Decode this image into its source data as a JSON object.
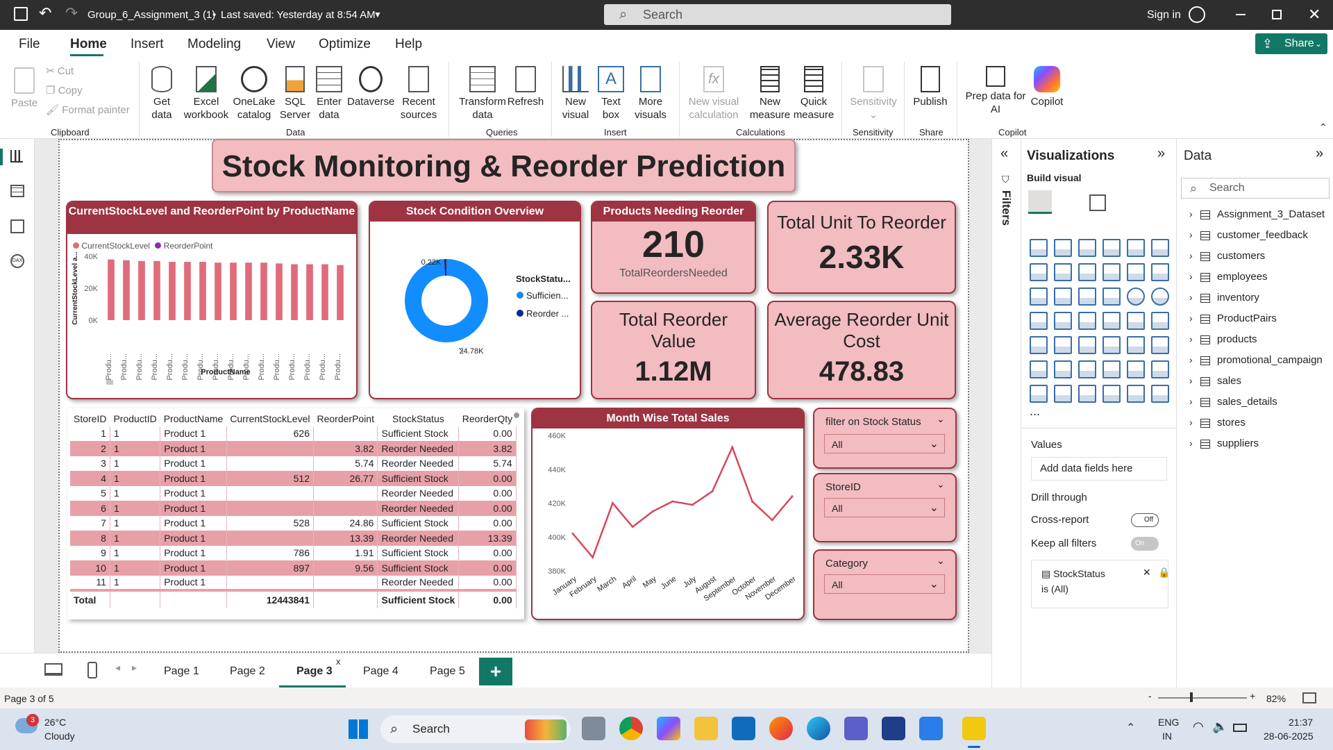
{
  "titlebar": {
    "doc_title": "Group_6_Assignment_3 (1)",
    "saved": "Last saved: Yesterday at 8:54 AM",
    "search_placeholder": "Search",
    "sign_in": "Sign in"
  },
  "menu": {
    "items": [
      "File",
      "Home",
      "Insert",
      "Modeling",
      "View",
      "Optimize",
      "Help"
    ],
    "active": "Home",
    "share": "Share"
  },
  "ribbon": {
    "clipboard": {
      "paste": "Paste",
      "cut": "Cut",
      "copy": "Copy",
      "format_painter": "Format painter",
      "group": "Clipboard"
    },
    "data": {
      "get_data": "Get\ndata",
      "excel": "Excel\nworkbook",
      "onelake": "OneLake\ncatalog",
      "sql": "SQL\nServer",
      "enter": "Enter\ndata",
      "dataverse": "Dataverse",
      "recent": "Recent\nsources",
      "group": "Data"
    },
    "queries": {
      "transform": "Transform\ndata",
      "refresh": "Refresh",
      "group": "Queries"
    },
    "insert": {
      "new_visual": "New\nvisual",
      "text_box": "Text\nbox",
      "more_visuals": "More\nvisuals",
      "group": "Insert"
    },
    "calculations": {
      "new_visual_calc": "New visual\ncalculation",
      "new_measure": "New\nmeasure",
      "quick_measure": "Quick\nmeasure",
      "group": "Calculations"
    },
    "sensitivity": {
      "label": "Sensitivity",
      "group": "Sensitivity"
    },
    "share": {
      "publish": "Publish",
      "group": "Share"
    },
    "copilot": {
      "prep": "Prep data for\nAI",
      "copilot": "Copilot",
      "group": "Copilot"
    }
  },
  "report": {
    "title": "Stock Monitoring & Reorder Prediction",
    "bar_chart": {
      "title": "CurrentStockLevel and ReorderPoint by ProductName",
      "legend": [
        "CurrentStockLevel",
        "ReorderPoint"
      ],
      "ylabel": "CurrentStockLevel a...",
      "xlabel": "ProductName",
      "yticks": [
        "40K",
        "20K",
        "0K"
      ],
      "xtick": "Produ..."
    },
    "donut": {
      "title": "Stock Condition Overview",
      "legend_title": "StockStatu...",
      "legend": [
        "Sufficien...",
        "Reorder ..."
      ],
      "label_small": "0.22K",
      "label_large": "24.78K"
    },
    "kpi_reorder": {
      "title": "Products Needing Reorder",
      "value": "210",
      "sub": "TotalReordersNeeded"
    },
    "kpi_units": {
      "title": "Total Unit To Reorder",
      "value": "2.33K"
    },
    "kpi_value": {
      "title": "Total Reorder Value",
      "value": "1.12M"
    },
    "kpi_cost": {
      "title": "Average Reorder Unit Cost",
      "value": "478.83"
    },
    "table": {
      "headers": [
        "StoreID",
        "ProductID",
        "ProductName",
        "CurrentStockLevel",
        "ReorderPoint",
        "StockStatus",
        "ReorderQty"
      ],
      "rows": [
        [
          "1",
          "1",
          "Product 1",
          "626",
          "",
          "Sufficient Stock",
          "0.00"
        ],
        [
          "2",
          "1",
          "Product 1",
          "",
          "3.82",
          "Reorder Needed",
          "3.82"
        ],
        [
          "3",
          "1",
          "Product 1",
          "",
          "5.74",
          "Reorder Needed",
          "5.74"
        ],
        [
          "4",
          "1",
          "Product 1",
          "512",
          "26.77",
          "Sufficient Stock",
          "0.00"
        ],
        [
          "5",
          "1",
          "Product 1",
          "",
          "",
          "Reorder Needed",
          "0.00"
        ],
        [
          "6",
          "1",
          "Product 1",
          "",
          "",
          "Reorder Needed",
          "0.00"
        ],
        [
          "7",
          "1",
          "Product 1",
          "528",
          "24.86",
          "Sufficient Stock",
          "0.00"
        ],
        [
          "8",
          "1",
          "Product 1",
          "",
          "13.39",
          "Reorder Needed",
          "13.39"
        ],
        [
          "9",
          "1",
          "Product 1",
          "786",
          "1.91",
          "Sufficient Stock",
          "0.00"
        ],
        [
          "10",
          "1",
          "Product 1",
          "897",
          "9.56",
          "Sufficient Stock",
          "0.00"
        ],
        [
          "11",
          "1",
          "Product 1",
          "",
          "",
          "Reorder Needed",
          "0.00"
        ]
      ],
      "total": [
        "Total",
        "",
        "",
        "12443841",
        "",
        "Sufficient Stock",
        "0.00"
      ]
    },
    "line_chart": {
      "title": "Month Wise Total Sales"
    },
    "slicers": [
      {
        "label": "filter on Stock Status",
        "value": "All"
      },
      {
        "label": "StoreID",
        "value": "All"
      },
      {
        "label": "Category",
        "value": "All"
      }
    ]
  },
  "chart_data": [
    {
      "type": "bar",
      "title": "CurrentStockLevel and ReorderPoint by ProductName",
      "categories": [
        "Produ...",
        "Produ...",
        "Produ...",
        "Produ...",
        "Produ...",
        "Produ...",
        "Produ...",
        "Produ...",
        "Produ...",
        "Produ...",
        "Produ...",
        "Produ...",
        "Produ...",
        "Produ...",
        "Produ...",
        "Produ..."
      ],
      "series": [
        {
          "name": "CurrentStockLevel",
          "values": [
            38000,
            37500,
            37000,
            37000,
            36500,
            36500,
            36500,
            36000,
            36000,
            36000,
            36000,
            35500,
            35000,
            35000,
            35000,
            34500
          ]
        },
        {
          "name": "ReorderPoint",
          "values": [
            0,
            0,
            0,
            0,
            0,
            0,
            0,
            0,
            0,
            0,
            0,
            0,
            0,
            0,
            0,
            0
          ]
        }
      ],
      "xlabel": "ProductName",
      "ylabel": "CurrentStockLevel a...",
      "ylim": [
        0,
        40000
      ],
      "color": "#e06c7b"
    },
    {
      "type": "pie",
      "title": "Stock Condition Overview",
      "slices": [
        {
          "name": "Sufficien...",
          "value": 24780,
          "color": "#118dff"
        },
        {
          "name": "Reorder ...",
          "value": 220,
          "color": "#12239e"
        }
      ]
    },
    {
      "type": "line",
      "title": "Month Wise Total Sales",
      "categories": [
        "January",
        "February",
        "March",
        "April",
        "May",
        "June",
        "July",
        "August",
        "September",
        "October",
        "November",
        "December"
      ],
      "values": [
        402000,
        388000,
        420000,
        406000,
        415000,
        421000,
        419000,
        427000,
        453000,
        421000,
        410000,
        424000
      ],
      "yticks": [
        "460K",
        "440K",
        "420K",
        "400K",
        "380K"
      ],
      "ylim": [
        380000,
        460000
      ],
      "color": "#d8465a"
    }
  ],
  "filters_label": "Filters",
  "visualizations": {
    "title": "Visualizations",
    "build": "Build visual",
    "values": "Values",
    "add_fields": "Add data fields here",
    "drill": "Drill through",
    "cross_report": "Cross-report",
    "cross_toggle": "Off",
    "keep_filters": "Keep all filters",
    "keep_toggle": "On",
    "filter_card_field": "StockStatus",
    "filter_card_value": "is (All)",
    "more": "..."
  },
  "datapane": {
    "title": "Data",
    "search": "Search",
    "tables": [
      "Assignment_3_Dataset",
      "customer_feedback",
      "customers",
      "employees",
      "inventory",
      "ProductPairs",
      "products",
      "promotional_campaign",
      "sales",
      "sales_details",
      "stores",
      "suppliers"
    ]
  },
  "pages": [
    "Page 1",
    "Page 2",
    "Page 3",
    "Page 4",
    "Page 5"
  ],
  "active_page": "Page 3",
  "status": {
    "page": "Page 3 of 5",
    "zoom": "82%"
  },
  "taskbar": {
    "temp": "26°C",
    "weather": "Cloudy",
    "badge": "3",
    "search": "Search",
    "lang1": "ENG",
    "lang2": "IN",
    "time": "21:37",
    "date": "28-06-2025"
  },
  "colors": {
    "accent_dark": "#9e3341",
    "card_pink": "#f2bcc1",
    "bar_pink": "#e06c7b",
    "donut_blue": "#118dff",
    "share_green": "#117865"
  }
}
